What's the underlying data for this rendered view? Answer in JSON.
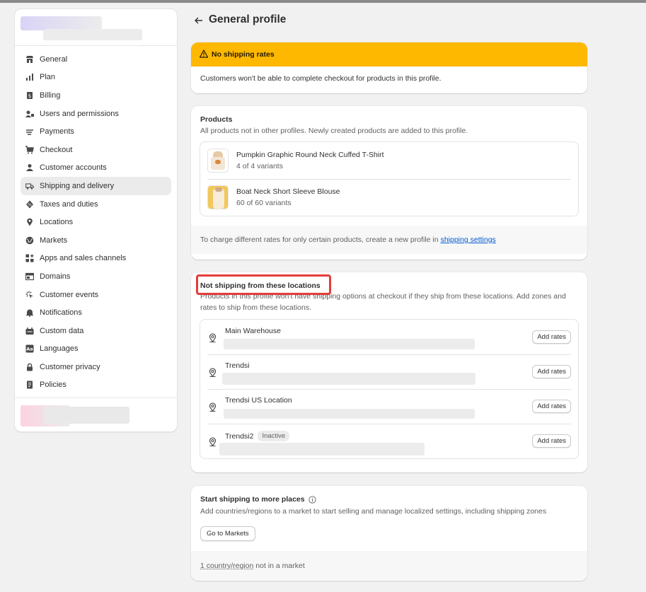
{
  "header": {
    "title": "General profile"
  },
  "sidebar": {
    "items": [
      {
        "label": "General",
        "icon": "store-icon"
      },
      {
        "label": "Plan",
        "icon": "plan-icon"
      },
      {
        "label": "Billing",
        "icon": "billing-icon"
      },
      {
        "label": "Users and permissions",
        "icon": "users-icon"
      },
      {
        "label": "Payments",
        "icon": "payments-icon"
      },
      {
        "label": "Checkout",
        "icon": "cart-icon"
      },
      {
        "label": "Customer accounts",
        "icon": "person-icon"
      },
      {
        "label": "Shipping and delivery",
        "icon": "truck-icon",
        "active": true
      },
      {
        "label": "Taxes and duties",
        "icon": "tax-icon"
      },
      {
        "label": "Locations",
        "icon": "location-icon"
      },
      {
        "label": "Markets",
        "icon": "globe-icon"
      },
      {
        "label": "Apps and sales channels",
        "icon": "apps-icon"
      },
      {
        "label": "Domains",
        "icon": "domain-icon"
      },
      {
        "label": "Customer events",
        "icon": "events-icon"
      },
      {
        "label": "Notifications",
        "icon": "bell-icon"
      },
      {
        "label": "Custom data",
        "icon": "data-icon"
      },
      {
        "label": "Languages",
        "icon": "language-icon"
      },
      {
        "label": "Customer privacy",
        "icon": "lock-icon"
      },
      {
        "label": "Policies",
        "icon": "policy-icon"
      }
    ]
  },
  "warning": {
    "title": "No shipping rates",
    "body": "Customers won't be able to complete checkout for products in this profile."
  },
  "products": {
    "title": "Products",
    "subtitle": "All products not in other profiles. Newly created products are added to this profile.",
    "items": [
      {
        "name": "Pumpkin Graphic Round Neck Cuffed T-Shirt",
        "variants": "4 of 4 variants"
      },
      {
        "name": "Boat Neck Short Sleeve Blouse",
        "variants": "60 of 60 variants"
      }
    ],
    "footer_text": "To charge different rates for only certain products, create a new profile in",
    "footer_link": "shipping settings"
  },
  "locations": {
    "title": "Not shipping from these locations",
    "subtitle": "Products in this profile won't have shipping options at checkout if they ship from these locations. Add zones and rates to ship from these locations.",
    "items": [
      {
        "name": "Main Warehouse",
        "badge": "",
        "button": "Add rates"
      },
      {
        "name": "Trendsi",
        "badge": "",
        "button": "Add rates"
      },
      {
        "name": "Trendsi US Location",
        "badge": "",
        "button": "Add rates"
      },
      {
        "name": "Trendsi2",
        "badge": "Inactive",
        "button": "Add rates"
      }
    ]
  },
  "markets": {
    "title": "Start shipping to more places",
    "subtitle": "Add countries/regions to a market to start selling and manage localized settings, including shipping zones",
    "button": "Go to Markets",
    "footer_link": "1 country/region",
    "footer_text": "not in a market"
  },
  "colors": {
    "warning": "#ffb800",
    "highlight": "#e53b3b",
    "link": "#005bd3"
  }
}
